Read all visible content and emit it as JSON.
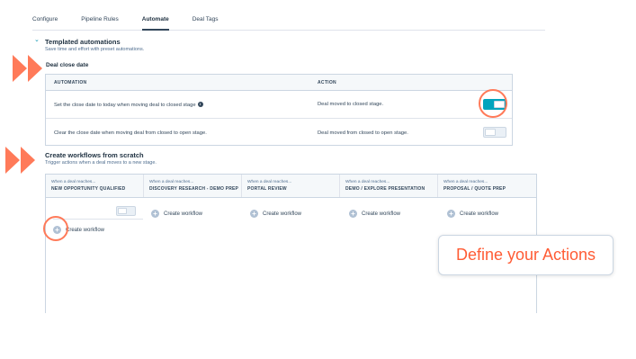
{
  "tabs": [
    {
      "label": "Configure",
      "active": false
    },
    {
      "label": "Pipeline Rules",
      "active": false
    },
    {
      "label": "Automate",
      "active": true
    },
    {
      "label": "Deal Tags",
      "active": false
    }
  ],
  "templated": {
    "title": "Templated automations",
    "subtitle": "Save time and effort with preset automations.",
    "subhead": "Deal close date",
    "headers": {
      "automation": "AUTOMATION",
      "action": "ACTION"
    },
    "rows": [
      {
        "automation": "Set the close date to today when moving deal to closed stage",
        "info_icon": "i",
        "action": "Deal moved to closed stage.",
        "toggle": "on"
      },
      {
        "automation": "Clear the close date when moving deal from closed to open stage.",
        "action": "Deal moved from closed to open stage.",
        "toggle": "off"
      }
    ]
  },
  "workflows": {
    "title": "Create workflows from scratch",
    "subtitle": "Trigger actions when a deal moves to a new stage.",
    "columns": [
      {
        "pre": "When a deal reaches...",
        "stage": "NEW OPPORTUNITY QUALIFIED"
      },
      {
        "pre": "When a deal reaches...",
        "stage": "DISCOVERY RESEARCH - DEMO PREP"
      },
      {
        "pre": "When a deal reaches...",
        "stage": "PORTAL REVIEW"
      },
      {
        "pre": "When a deal reaches...",
        "stage": "DEMO / EXPLORE PRESENTATION"
      },
      {
        "pre": "When a deal reaches...",
        "stage": "PROPOSAL / QUOTE PREP"
      }
    ],
    "create_label": "Create workflow",
    "plus": "+"
  },
  "callout": "Define your Actions",
  "colors": {
    "accent_orange": "#ff7a59",
    "toggle_on": "#00a4bd",
    "text_dark": "#33475b",
    "callout_text": "#ff5c35"
  }
}
